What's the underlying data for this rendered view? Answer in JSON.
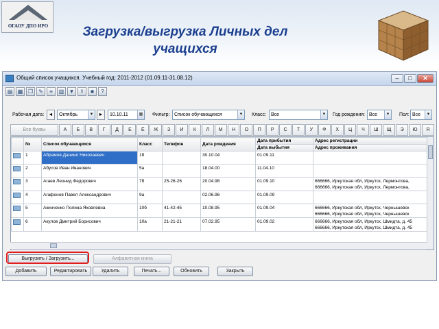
{
  "slide": {
    "logo_text": "ОГАОУ ДПО ИРО",
    "title_line1": "Загрузка/выгрузка Личных дел",
    "title_line2": "учащихся"
  },
  "window": {
    "title": "Общий список учащихся. Учебный год: 2011-2012 (01.09.11-31.08.12)",
    "min": "–",
    "max": "□",
    "close": "✕"
  },
  "toolbar_icons": [
    "print-icon",
    "table-icon",
    "copy-icon",
    "edit-icon",
    "list-icon",
    "grid-icon",
    "filter-icon",
    "export-icon",
    "save-icon",
    "help-icon"
  ],
  "filters": {
    "workdate_label": "Рабочая дата:",
    "month": "Октябрь",
    "date": "10.10.11",
    "filter_label": "Фильтр:",
    "filter_value": "Список обучающихся",
    "class_label": "Класс:",
    "class_value": "Все",
    "birthyear_label": "Год рождения:",
    "birthyear_value": "Все",
    "sex_label": "Пол:",
    "sex_value": "Все"
  },
  "letters": {
    "all": "Все буквы",
    "items": [
      "А",
      "Б",
      "В",
      "Г",
      "Д",
      "Е",
      "Ё",
      "Ж",
      "З",
      "И",
      "К",
      "Л",
      "М",
      "Н",
      "О",
      "П",
      "Р",
      "С",
      "Т",
      "У",
      "Ф",
      "Х",
      "Ц",
      "Ч",
      "Ш",
      "Щ",
      "Э",
      "Ю",
      "Я"
    ]
  },
  "grid": {
    "columns": [
      "№",
      "Список обучающихся",
      "Класс",
      "Телефон",
      "Дата рождения",
      "Дата прибытия",
      "Адрес регистрации"
    ],
    "columns_sub": [
      "Дата выбытия",
      "Адрес проживания"
    ],
    "rows": [
      {
        "n": "1",
        "name": "Абрамов Даниил Николаевич",
        "class": "1б",
        "phone": "",
        "birth": "30.10.04",
        "arrive": "01.09.11",
        "leave": "",
        "addr1": "",
        "addr2": ""
      },
      {
        "n": "2",
        "name": "Абусов Иван Иванович",
        "class": "5а",
        "phone": "",
        "birth": "18.04.00",
        "arrive": "11.04.10",
        "leave": "",
        "addr1": "",
        "addr2": ""
      },
      {
        "n": "3",
        "name": "Агаев Леонид Федорович",
        "class": "7б",
        "phone": "25-26-26",
        "birth": "20.04.98",
        "arrive": "01.09.10",
        "leave": "",
        "addr1": "666666, Иркутская обл, Иркутск, Лермонтова,",
        "addr2": "666666, Иркутская обл, Иркутск, Лермонтова,"
      },
      {
        "n": "4",
        "name": "Агафонов Павел Александрович",
        "class": "9а",
        "phone": "",
        "birth": "02.06.96",
        "arrive": "01.09.09",
        "leave": "",
        "addr1": "",
        "addr2": ""
      },
      {
        "n": "5",
        "name": "Акинченко Полина Яковлевна",
        "class": "10б",
        "phone": "41-42-45",
        "birth": "10.08.95",
        "arrive": "01.09.04",
        "leave": "",
        "addr1": "666666, Иркутская обл, Иркутск, Чернышевск",
        "addr2": "666666, Иркутская обл, Иркутск, Чернышевск"
      },
      {
        "n": "6",
        "name": "Акулов Дмитрий Борисович",
        "class": "10а",
        "phone": "21-21-21",
        "birth": "07.02.95",
        "arrive": "01.09.02",
        "leave": "",
        "addr1": "666666, Иркутская обл, Иркутск, Шмидта, д. 45",
        "addr2": "666666, Иркутская обл, Иркутск, Шмидта, д. 45"
      }
    ]
  },
  "buttons": {
    "upload": "Выгрузить / Загрузить...",
    "alpha_book": "Алфавитная книга",
    "add": "Добавить",
    "edit": "Редактировать",
    "delete": "Удалить",
    "print": "Печать...",
    "refresh": "Обновить",
    "close": "Закрыть"
  },
  "colors": {
    "title": "#1b3f8f",
    "selection": "#2f6fc8",
    "highlight": "#e31d1d"
  }
}
